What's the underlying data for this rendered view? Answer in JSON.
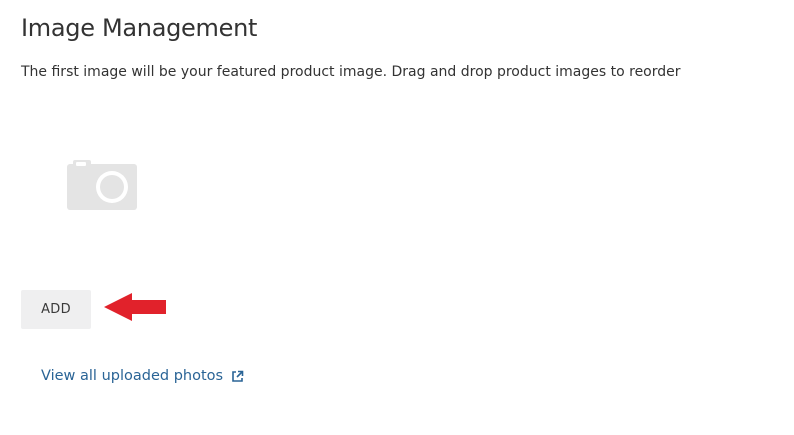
{
  "header": {
    "title": "Image Management"
  },
  "main": {
    "description": "The first image will be your featured product image. Drag and drop product images to reorder",
    "placeholder_icon": "camera-icon",
    "add_button_label": "ADD",
    "annotation_arrow_color": "#e1222b",
    "view_link": {
      "label": "View all uploaded photos",
      "icon": "external-link-icon",
      "color": "#2a6496"
    }
  }
}
